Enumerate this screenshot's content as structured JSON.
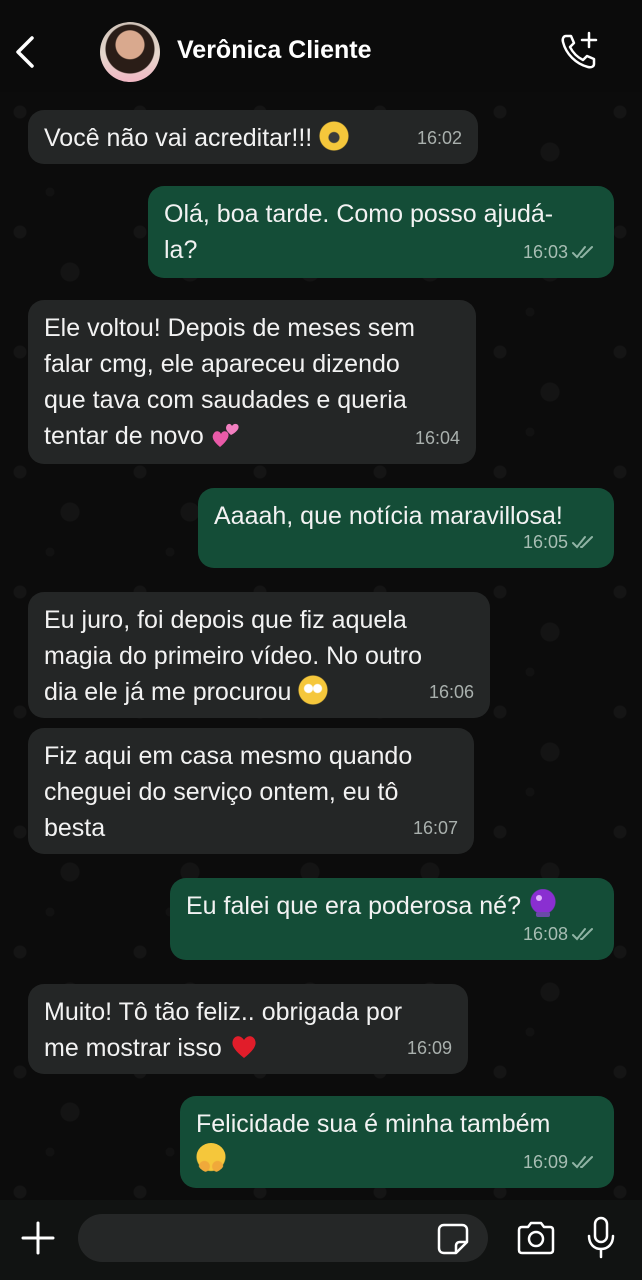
{
  "header": {
    "contact_name": "Verônica Cliente"
  },
  "messages": [
    {
      "dir": "in",
      "text": "Você não vai acreditar!!! ",
      "emoji": "scream-emoji",
      "time": "16:02"
    },
    {
      "dir": "out",
      "text": "Olá, boa tarde. Como posso ajudá-\nla?",
      "time": "16:03"
    },
    {
      "dir": "in",
      "text": "Ele voltou! Depois de meses sem\nfalar cmg, ele apareceu dizendo\nque tava com saudades e queria\ntentar de novo ",
      "emoji": "two-hearts-emoji",
      "time": "16:04"
    },
    {
      "dir": "out",
      "text": "Aaaah, que notícia maravillosa!",
      "time": "16:05"
    },
    {
      "dir": "in",
      "text": "Eu juro, foi depois que fiz aquela\nmagia do primeiro vídeo. No outro\ndia ele já me procurou ",
      "emoji": "flushed-emoji",
      "time": "16:06"
    },
    {
      "dir": "in",
      "text": "Fiz aqui em casa mesmo quando\ncheguei do serviço ontem, eu tô\nbesta",
      "time": "16:07"
    },
    {
      "dir": "out",
      "text": "Eu falei que era poderosa né? ",
      "emoji": "crystal-ball-emoji",
      "time": "16:08"
    },
    {
      "dir": "in",
      "text": "Muito! Tô tão feliz.. obrigada por\nme mostrar isso ",
      "emoji": "red-heart-emoji",
      "time": "16:09"
    },
    {
      "dir": "out",
      "text": "Felicidade sua é minha também\n",
      "emoji": "hugging-emoji",
      "time": "16:09"
    }
  ],
  "composer": {
    "placeholder": ""
  },
  "colors": {
    "incoming_bubble": "#242626",
    "outgoing_bubble": "#144d37",
    "background": "#0b0b0b"
  }
}
